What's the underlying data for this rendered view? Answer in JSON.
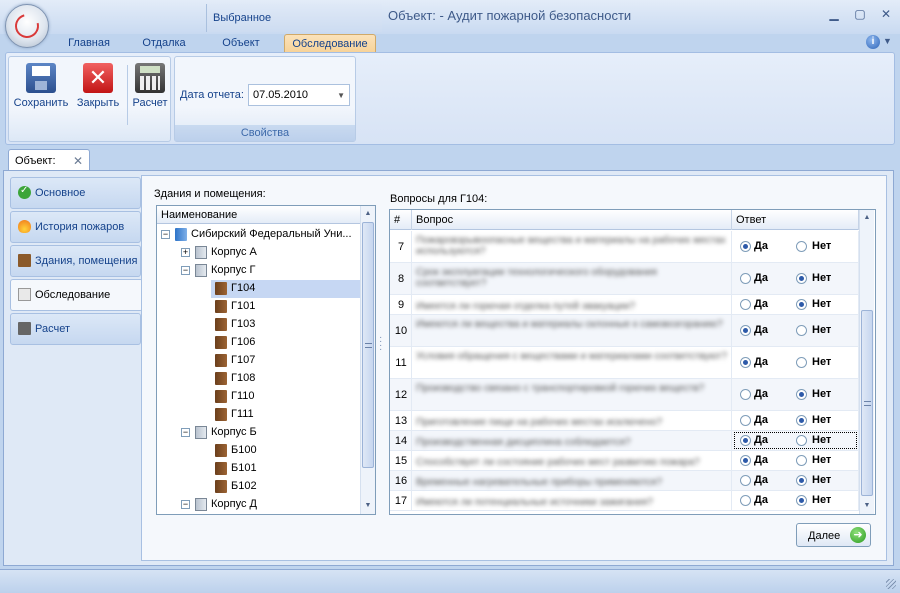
{
  "window": {
    "title": "Объект:  - Аудит пожарной безопасности",
    "context_group": "Выбранное"
  },
  "ribbon": {
    "tabs": [
      {
        "label": "Главная",
        "active": false
      },
      {
        "label": "Отдалка",
        "active": false
      },
      {
        "label": "Объект",
        "active": false
      },
      {
        "label": "Обследование",
        "active": true
      }
    ],
    "buttons": {
      "save": "Сохранить",
      "close": "Закрыть",
      "calc": "Расчет"
    },
    "properties": {
      "date_label": "Дата отчета:",
      "date_value": "07.05.2010",
      "caption": "Свойства"
    }
  },
  "document_tab": {
    "label": "Объект:"
  },
  "nav": {
    "items": [
      {
        "label": "Основное",
        "icon": "check-icon",
        "active": false
      },
      {
        "label": "История пожаров",
        "icon": "fire-icon",
        "active": false
      },
      {
        "label": "Здания, помещения",
        "icon": "building-icon",
        "active": false
      },
      {
        "label": "Обследование",
        "icon": "document-icon",
        "active": true
      },
      {
        "label": "Расчет",
        "icon": "calculator-icon",
        "active": false
      }
    ]
  },
  "tree": {
    "label": "Здания и помещения:",
    "header": "Наименование",
    "nodes": [
      {
        "text": "Сибирский Федеральный Уни...",
        "level": 0,
        "type": "univ",
        "expander": "−"
      },
      {
        "text": "Корпус А",
        "level": 1,
        "type": "bldg",
        "expander": "+"
      },
      {
        "text": "Корпус Г",
        "level": 1,
        "type": "bldg",
        "expander": "−"
      },
      {
        "text": "Г104",
        "level": 2,
        "type": "room",
        "selected": true
      },
      {
        "text": "Г101",
        "level": 2,
        "type": "room"
      },
      {
        "text": "Г103",
        "level": 2,
        "type": "room"
      },
      {
        "text": "Г106",
        "level": 2,
        "type": "room"
      },
      {
        "text": "Г107",
        "level": 2,
        "type": "room"
      },
      {
        "text": "Г108",
        "level": 2,
        "type": "room"
      },
      {
        "text": "Г110",
        "level": 2,
        "type": "room"
      },
      {
        "text": "Г111",
        "level": 2,
        "type": "room"
      },
      {
        "text": "Корпус Б",
        "level": 1,
        "type": "bldg",
        "expander": "−"
      },
      {
        "text": "Б100",
        "level": 2,
        "type": "room"
      },
      {
        "text": "Б101",
        "level": 2,
        "type": "room"
      },
      {
        "text": "Б102",
        "level": 2,
        "type": "room"
      },
      {
        "text": "Корпус Д",
        "level": 1,
        "type": "bldg",
        "expander": "−"
      }
    ]
  },
  "questions": {
    "label": "Вопросы для Г104:",
    "columns": {
      "num": "#",
      "question": "Вопрос",
      "answer": "Ответ"
    },
    "yes_label": "Да",
    "no_label": "Нет",
    "rows": [
      {
        "num": "7",
        "text": "Пожаровзрывоопасные вещества и материалы на рабочих местах используются?",
        "answer": "yes"
      },
      {
        "num": "8",
        "text": "Срок эксплуатации технологического оборудования соответствует?",
        "answer": "no"
      },
      {
        "num": "9",
        "text": "Имеется ли горючая отделка путей эвакуации?",
        "answer": "no"
      },
      {
        "num": "10",
        "text": "Имеются ли вещества и материалы склонные к самовозгоранию?",
        "answer": "yes"
      },
      {
        "num": "11",
        "text": "Условия обращения с веществами и материалами соответствуют?",
        "answer": "yes"
      },
      {
        "num": "12",
        "text": "Производство связано с транспортировкой горючих веществ?",
        "answer": "no"
      },
      {
        "num": "13",
        "text": "Приготовление пищи на рабочих местах исключено?",
        "answer": "no"
      },
      {
        "num": "14",
        "text": "Производственная дисциплина соблюдается?",
        "answer": "yes"
      },
      {
        "num": "15",
        "text": "Способствует ли состояние рабочих мест развитию пожара?",
        "answer": "yes"
      },
      {
        "num": "16",
        "text": "Временные нагревательные приборы применяются?",
        "answer": "no"
      },
      {
        "num": "17",
        "text": "Имеются ли потенциальные источники зажигания?",
        "answer": "no"
      }
    ]
  },
  "next_button": {
    "label": "Далее"
  }
}
